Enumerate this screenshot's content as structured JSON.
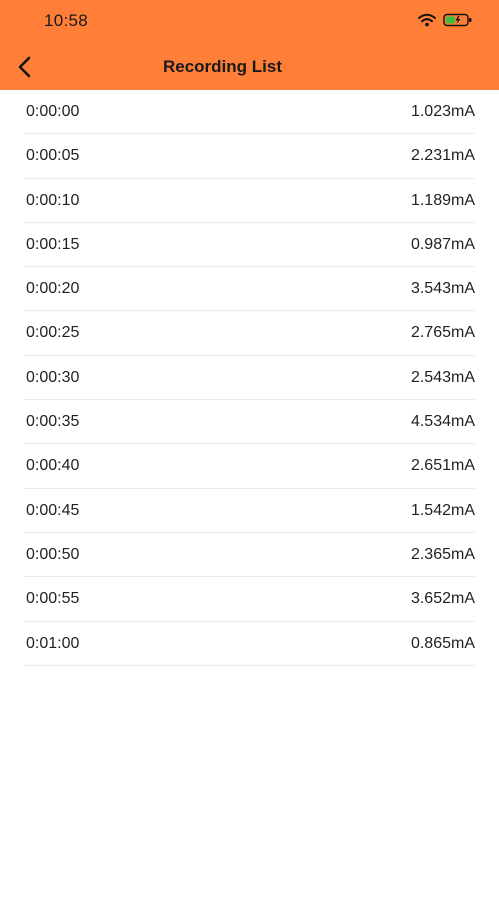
{
  "status_bar": {
    "time": "10:58",
    "icons": [
      "wifi-icon",
      "battery-charging-icon"
    ]
  },
  "header": {
    "title": "Recording List",
    "back_icon": "chevron-left-icon",
    "background_color": "#FF7F39"
  },
  "recordings": [
    {
      "time": "0:00:00",
      "value": "1.023mA"
    },
    {
      "time": "0:00:05",
      "value": "2.231mA"
    },
    {
      "time": "0:00:10",
      "value": "1.189mA"
    },
    {
      "time": "0:00:15",
      "value": "0.987mA"
    },
    {
      "time": "0:00:20",
      "value": "3.543mA"
    },
    {
      "time": "0:00:25",
      "value": "2.765mA"
    },
    {
      "time": "0:00:30",
      "value": "2.543mA"
    },
    {
      "time": "0:00:35",
      "value": "4.534mA"
    },
    {
      "time": "0:00:40",
      "value": "2.651mA"
    },
    {
      "time": "0:00:45",
      "value": "1.542mA"
    },
    {
      "time": "0:00:50",
      "value": "2.365mA"
    },
    {
      "time": "0:00:55",
      "value": "3.652mA"
    },
    {
      "time": "0:01:00",
      "value": "0.865mA"
    }
  ]
}
